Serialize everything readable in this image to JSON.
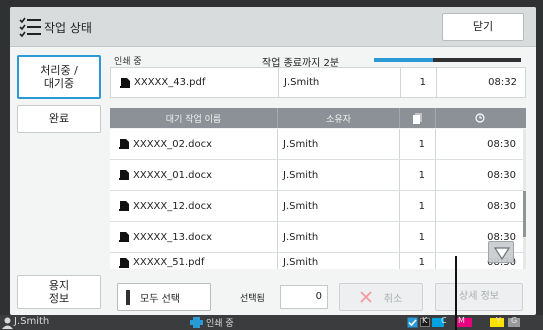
{
  "header": {
    "title": "작업 상태",
    "close_label": "닫기",
    "icon": "job-list-icon"
  },
  "tabs": [
    {
      "label_line1": "처리중 /",
      "label_line2": "대기중",
      "active": true
    },
    {
      "label": "완료",
      "active": false
    },
    {
      "label_line1": "용지",
      "label_line2": "정보",
      "active": false
    }
  ],
  "current_job": {
    "section_label": "인쇄 중",
    "remaining_text": "작업 종료까지 2분",
    "progress_fraction": 0.4,
    "name": "XXXXX_43.pdf",
    "owner": "J.Smith",
    "copies": "1",
    "time": "08:32"
  },
  "queue": {
    "columns": {
      "name": "대기 작업 이름",
      "owner": "소유자",
      "copies_icon": "pages-icon",
      "time_icon": "clock-icon"
    },
    "rows": [
      {
        "name": "XXXXX_02.docx",
        "owner": "J.Smith",
        "copies": "1",
        "time": "08:30"
      },
      {
        "name": "XXXXX_01.docx",
        "owner": "J.Smith",
        "copies": "1",
        "time": "08:30"
      },
      {
        "name": "XXXXX_12.docx",
        "owner": "J.Smith",
        "copies": "1",
        "time": "08:30"
      },
      {
        "name": "XXXXX_13.docx",
        "owner": "J.Smith",
        "copies": "1",
        "time": "08:30"
      },
      {
        "name": "XXXXX_51.pdf",
        "owner": "J.Smith",
        "copies": "1",
        "time": "08:30"
      }
    ]
  },
  "footer": {
    "select_all_label": "모두 선택",
    "selected_label": "선택됨",
    "selected_count": "0",
    "cancel_label": "취소",
    "details_label": "상세 정보"
  },
  "status_bar": {
    "user": "J.Smith",
    "activity": "인쇄 중",
    "inks": [
      {
        "label": "K",
        "color": "#1a1a1a"
      },
      {
        "label": "C",
        "color": "#00a3e0"
      },
      {
        "label": "M",
        "color": "#e6007e"
      },
      {
        "label": "Y",
        "color": "#ffe100"
      },
      {
        "label": "G",
        "color": "#9a9a9a"
      }
    ]
  },
  "colors": {
    "accent": "#2a9ad6",
    "header_bg": "#d9dcdd",
    "table_header_bg": "#8b9196"
  }
}
